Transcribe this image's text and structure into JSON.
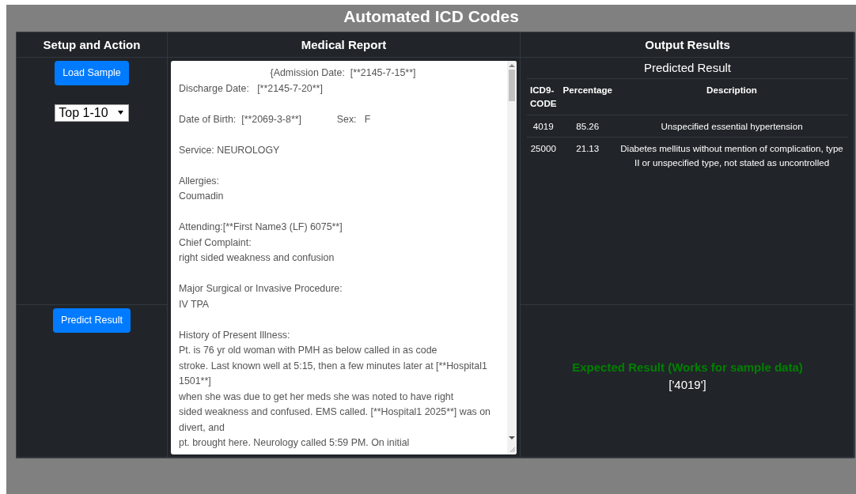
{
  "title": "Automated ICD Codes",
  "columns": [
    "Setup and Action",
    "Medical Report",
    "Output Results"
  ],
  "setup": {
    "load_button": "Load Sample",
    "select_value": "Top 1-10",
    "predict_button": "Predict Result"
  },
  "report": {
    "paragraphs": [
      [
        "{Admission Date:  [**2145-7-15**]",
        "Discharge Date:   [**2145-7-20**]"
      ],
      [
        "Date of Birth:  [**2069-3-8**]             Sex:   F"
      ],
      [
        "Service: NEUROLOGY"
      ],
      [
        "Allergies:",
        "Coumadin"
      ],
      [
        "Attending:[**First Name3 (LF) 6075**]",
        "Chief Complaint:",
        "right sided weakness and confusion"
      ],
      [
        "Major Surgical or Invasive Procedure:",
        "IV TPA"
      ],
      [
        "History of Present Illness:",
        "Pt. is 76 yr old woman with PMH as below called in as code",
        "stroke. Last known well at 5:15, then a few minutes later at [**Hospital1",
        "1501**]",
        "when she was due to get her meds she was noted to have right",
        "sided weakness and confused. EMS called. [**Hospital1 2025**] was on",
        "divert, and",
        "pt. brought here. Neurology called 5:59 PM. On initial"
      ]
    ]
  },
  "output": {
    "predicted_title": "Predicted Result",
    "table": {
      "columns": [
        "ICD9-CODE",
        "Percentage",
        "Description"
      ],
      "rows": [
        [
          "4019",
          "85.26",
          "Unspecified essential hypertension"
        ],
        [
          "25000",
          "21.13",
          "Diabetes mellitus without mention of complication, type II or unspecified type, not stated as uncontrolled"
        ]
      ]
    },
    "expected_title": "Expected Result (Works for sample data)",
    "expected_value": "['4019']"
  }
}
